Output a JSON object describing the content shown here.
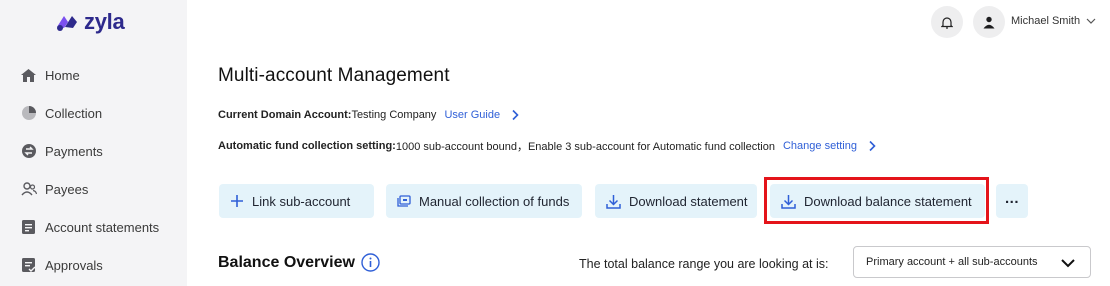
{
  "brand": {
    "name": "zyla",
    "primary_color": "#2e2a8c",
    "accent_color": "#7b4ff0"
  },
  "sidebar": {
    "items": [
      {
        "label": "Home",
        "icon": "home-icon"
      },
      {
        "label": "Collection",
        "icon": "pie-chart-icon"
      },
      {
        "label": "Payments",
        "icon": "payment-icon"
      },
      {
        "label": "Payees",
        "icon": "people-icon"
      },
      {
        "label": "Account statements",
        "icon": "statement-icon"
      },
      {
        "label": "Approvals",
        "icon": "approval-icon"
      }
    ]
  },
  "header": {
    "user_name": "Michael Smith",
    "notification_icon": "bell-icon",
    "avatar_icon": "user-icon"
  },
  "main": {
    "title": "Multi-account Management",
    "domain_label": "Current Domain Account:",
    "domain_value": "Testing Company",
    "user_guide_link": "User Guide",
    "auto_label": "Automatic fund collection setting:",
    "auto_value": "1000 sub-account bound，Enable 3 sub-account for Automatic fund collection",
    "change_setting_link": "Change setting",
    "actions": {
      "link_sub_account": "Link sub-account",
      "manual_collection": "Manual collection of funds",
      "download_statement": "Download statement",
      "download_balance_statement": "Download balance statement",
      "more": "..."
    },
    "balance_overview_title": "Balance Overview",
    "range_label": "The total balance range you are looking at is:",
    "range_select_value": "Primary account + all sub-accounts"
  },
  "colors": {
    "button_bg": "#e4f3fa",
    "link": "#2f5fd7",
    "highlight_border": "#e4141a",
    "sidebar_bg": "#f4f4f6"
  }
}
